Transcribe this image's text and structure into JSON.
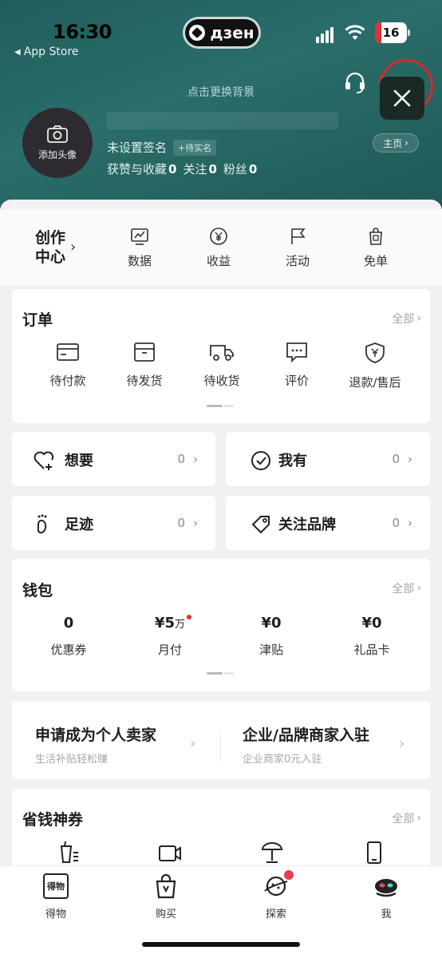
{
  "status_bar": {
    "time": "16:30",
    "back_label": "App Store",
    "dzen_label": "дзен",
    "battery": "16"
  },
  "profile": {
    "change_bg": "点击更换背景",
    "avatar_label": "添加头像",
    "signature": "未设置签名",
    "verify_tag": "+待实名",
    "likes_label": "获赞与收藏",
    "likes": "0",
    "following_label": "关注",
    "following": "0",
    "fans_label": "粉丝",
    "fans": "0",
    "home_button": "主页"
  },
  "quick_row": {
    "creator_line1": "创作",
    "creator_line2": "中心",
    "items": [
      {
        "label": "数据",
        "icon": "chart-icon"
      },
      {
        "label": "收益",
        "icon": "yen-coin-icon"
      },
      {
        "label": "活动",
        "icon": "flag-icon"
      },
      {
        "label": "免单",
        "icon": "bag-icon"
      }
    ]
  },
  "orders": {
    "title": "订单",
    "all_label": "全部",
    "items": [
      {
        "label": "待付款",
        "icon": "card-icon"
      },
      {
        "label": "待发货",
        "icon": "box-icon"
      },
      {
        "label": "待收货",
        "icon": "truck-icon"
      },
      {
        "label": "评价",
        "icon": "comment-icon"
      },
      {
        "label": "退款/售后",
        "icon": "shield-yen-icon"
      }
    ]
  },
  "collections": [
    {
      "label": "想要",
      "count": "0",
      "icon": "heart-plus-icon"
    },
    {
      "label": "我有",
      "count": "0",
      "icon": "check-circle-icon"
    },
    {
      "label": "足迹",
      "count": "0",
      "icon": "footprint-icon"
    },
    {
      "label": "关注品牌",
      "count": "0",
      "icon": "tag-icon"
    }
  ],
  "wallet": {
    "title": "钱包",
    "all_label": "全部",
    "items": [
      {
        "value": "0",
        "unit": "",
        "label": "优惠券"
      },
      {
        "value": "¥5",
        "unit": "万",
        "label": "月付"
      },
      {
        "value": "¥0",
        "unit": "",
        "label": "津贴"
      },
      {
        "value": "¥0",
        "unit": "",
        "label": "礼品卡"
      }
    ]
  },
  "seller": {
    "personal_title": "申请成为个人卖家",
    "personal_sub": "生活补贴轻松赚",
    "brand_title": "企业/品牌商家入驻",
    "brand_sub": "企业商家0元入驻"
  },
  "coupons": {
    "title": "省钱神券",
    "all_label": "全部"
  },
  "tabbar": {
    "items": [
      {
        "label": "得物",
        "icon": "dewu-logo-icon"
      },
      {
        "label": "购买",
        "icon": "shopping-bag-icon"
      },
      {
        "label": "探索",
        "icon": "planet-icon"
      },
      {
        "label": "我",
        "icon": "avatar-icon"
      }
    ],
    "logo_text": "得物"
  },
  "colors": {
    "header": "#1f5e5c",
    "highlight_ring": "#d72828",
    "badge": "#e53d4a"
  }
}
